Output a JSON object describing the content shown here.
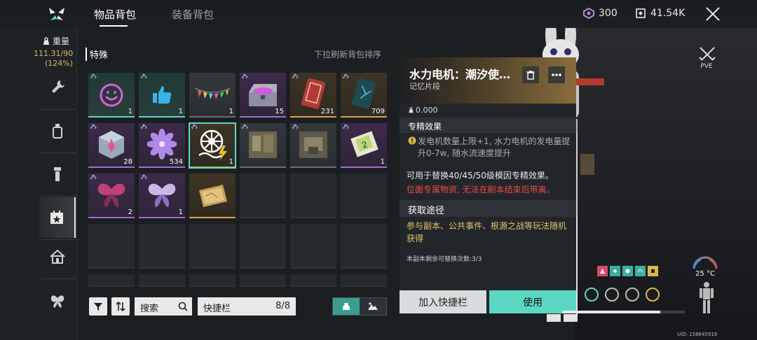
{
  "header": {
    "tabs": [
      {
        "label": "物品背包",
        "active": true
      },
      {
        "label": "装备背包",
        "active": false
      }
    ],
    "currency_a": "300",
    "currency_b": "41.54K"
  },
  "weight": {
    "label": "重量",
    "value": "111.31/90",
    "percent": "(124%)"
  },
  "inventory": {
    "section_title": "特殊",
    "refresh_hint": "下拉刷新背包排序",
    "items": [
      {
        "icon": "smiley-emote-icon",
        "count": "1",
        "rarity": "green"
      },
      {
        "icon": "thumbs-up-emote-icon",
        "count": "1",
        "rarity": "green"
      },
      {
        "icon": "pennant-banner-icon",
        "count": "1",
        "rarity": "grey"
      },
      {
        "icon": "treasure-chest-icon",
        "count": "15",
        "rarity": "purple"
      },
      {
        "icon": "red-card-icon",
        "count": "231",
        "rarity": "gold"
      },
      {
        "icon": "teal-card-icon",
        "count": "709",
        "rarity": "gold"
      },
      {
        "icon": "crystal-cube-icon",
        "count": "28",
        "rarity": "purple"
      },
      {
        "icon": "purple-flower-icon",
        "count": "534",
        "rarity": "purple"
      },
      {
        "icon": "water-turbine-icon",
        "count": "1",
        "rarity": "gold"
      },
      {
        "icon": "memory-photo-icon",
        "count": "",
        "rarity": "grey"
      },
      {
        "icon": "memory-photo-icon",
        "count": "",
        "rarity": "grey"
      },
      {
        "icon": "ticket-card-icon",
        "count": "1",
        "rarity": "purple"
      },
      {
        "icon": "pink-butterfly-icon",
        "count": "2",
        "rarity": "purple"
      },
      {
        "icon": "violet-butterfly-icon",
        "count": "1",
        "rarity": "purple"
      },
      {
        "icon": "map-parcel-icon",
        "count": "",
        "rarity": "gold"
      }
    ]
  },
  "bottom": {
    "search_label": "搜索",
    "quickbar_label": "快捷栏",
    "quickbar_count": "8/8"
  },
  "tooltip": {
    "title": "水力电机：潮汐使…",
    "subtitle": "记忆片段",
    "weight": "0.000",
    "effect_heading": "专精效果",
    "effect_text": "发电机数量上限+1, 水力电机的发电量提升0-7w, 随水流速度提升",
    "desc_1": "可用于替换40/45/50级模因专精效果。",
    "desc_2": "位面专属物资, 无法在剧本结束后带离。",
    "acquire_heading": "获取途径",
    "acquire_text": "参与副本、公共事件、根源之战等玩法随机获得",
    "remaining": "本副本剩余可替换次数:3/3",
    "btn_quick": "加入快捷栏",
    "btn_use": "使用"
  },
  "right": {
    "pve_label": "PVE",
    "temperature": "25 °C",
    "uid": "UID: 158645919"
  },
  "colors": {
    "accent_teal": "#5cd8c2",
    "gold_text": "#e2c46a",
    "warning_red": "#ec4a4a"
  }
}
